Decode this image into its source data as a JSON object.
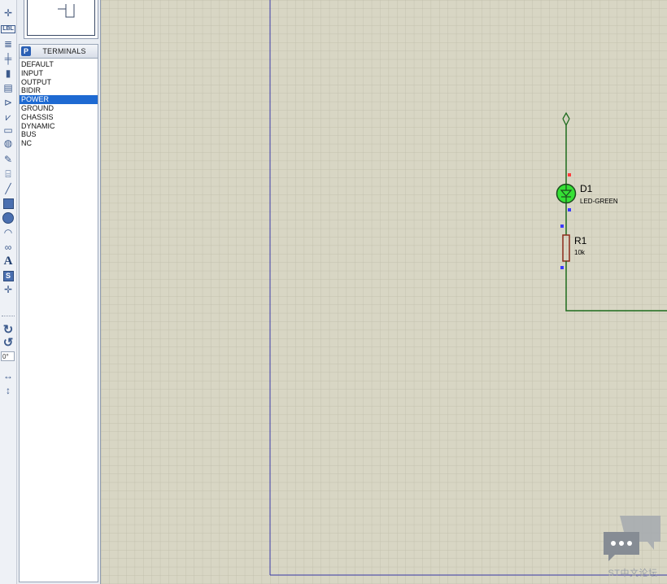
{
  "panel": {
    "title": "TERMINALS",
    "p_button": "P",
    "items": [
      {
        "label": "DEFAULT",
        "selected": false
      },
      {
        "label": "INPUT",
        "selected": false
      },
      {
        "label": "OUTPUT",
        "selected": false
      },
      {
        "label": "BIDIR",
        "selected": false
      },
      {
        "label": "POWER",
        "selected": true
      },
      {
        "label": "GROUND",
        "selected": false
      },
      {
        "label": "CHASSIS",
        "selected": false
      },
      {
        "label": "DYNAMIC",
        "selected": false
      },
      {
        "label": "BUS",
        "selected": false
      },
      {
        "label": "NC",
        "selected": false
      }
    ]
  },
  "toolbar": {
    "lbl_text": "LBL",
    "text_tool": "A",
    "symbol_tool": "S",
    "rotation_value": "0°"
  },
  "schematic": {
    "components": [
      {
        "ref": "D1",
        "value": "LED-GREEN",
        "type": "led"
      },
      {
        "ref": "R1",
        "value": "10k",
        "type": "resistor"
      }
    ],
    "colors": {
      "canvas_bg": "#d8d6c4",
      "grid": "#c3c1ae",
      "wire": "#1d6b1d",
      "sheet_border": "#3a3aa8",
      "led_fill": "#35e035",
      "resistor": "#8b2a1a",
      "pin_blue": "#3b3bff",
      "pin_red": "#ff3b3b",
      "selection": "#1e6ad2"
    }
  },
  "watermark": {
    "text": "ST中文论坛",
    "icon": "chat-bubbles-icon"
  }
}
